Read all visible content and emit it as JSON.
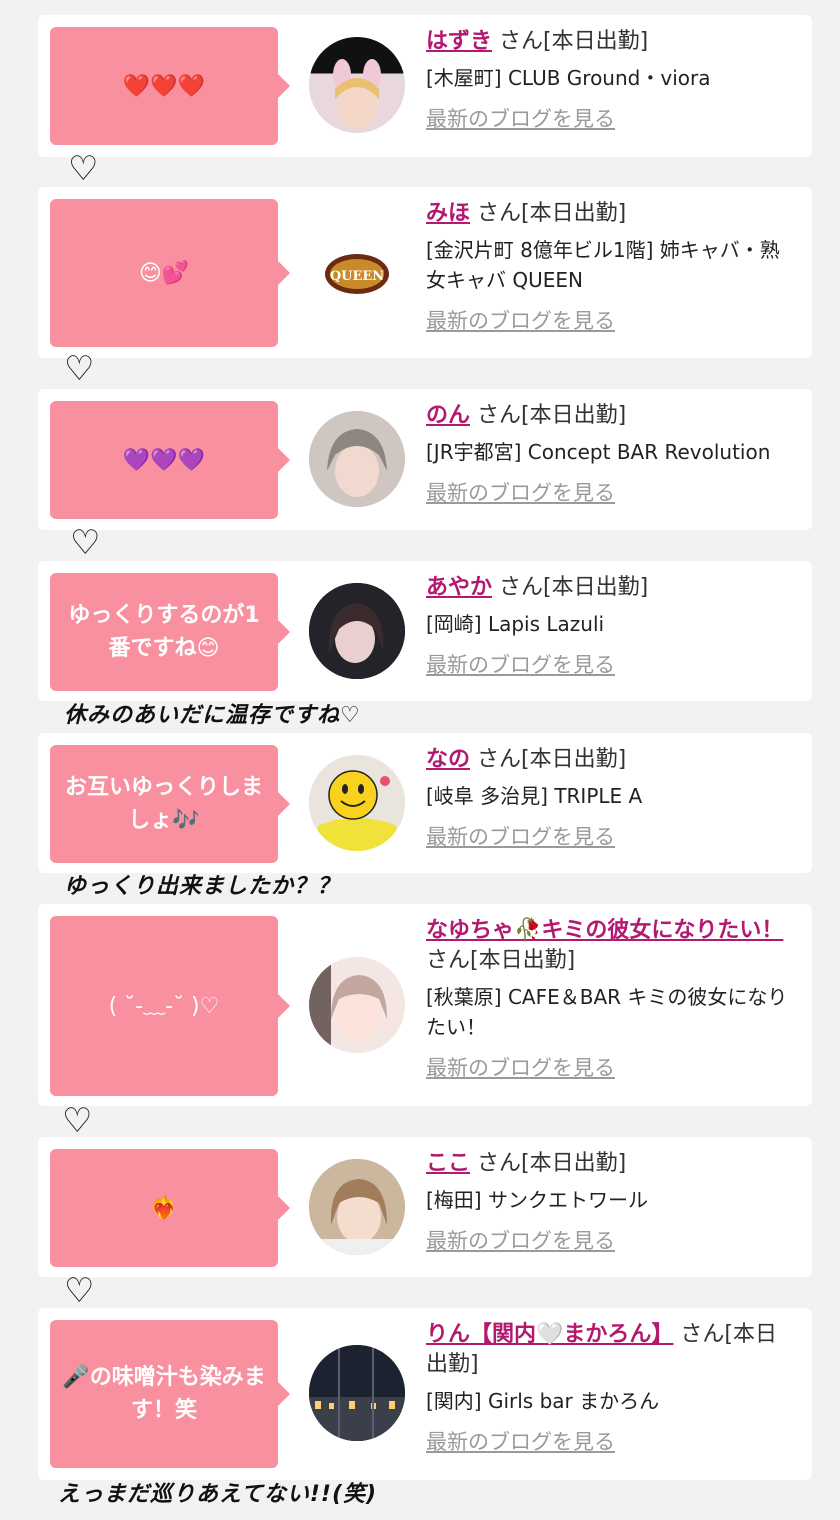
{
  "common": {
    "san": "さん",
    "status": "[本日出勤]",
    "blog_link": "最新のブログを見る"
  },
  "colors": {
    "bubble": "#f8909f",
    "name": "#b3196f",
    "link": "#9a9a9a",
    "background": "#f2f2f2"
  },
  "entries": [
    {
      "name": "はずき",
      "suffix": "さん[本日出勤]",
      "shop": "[木屋町] CLUB Ground・viora",
      "comment": "❤️❤️❤️",
      "blog": "最新のブログを見る",
      "avatar": "avatar-bunny-ears"
    },
    {
      "name": "みほ",
      "suffix": "さん[本日出勤]",
      "shop": "[金沢片町 8億年ビル1階] 姉キャバ・熟女キャバ QUEEN",
      "comment": "😊💕",
      "blog": "最新のブログを見る",
      "avatar": "avatar-queen-logo",
      "logo_text": "QUEEN"
    },
    {
      "name": "のん",
      "suffix": "さん[本日出勤]",
      "shop": "[JR宇都宮] Concept BAR Revolution",
      "comment": "💜💜💜",
      "blog": "最新のブログを見る",
      "avatar": "avatar-portrait"
    },
    {
      "name": "あやか",
      "suffix": "さん[本日出勤]",
      "shop": "[岡崎] Lapis Lazuli",
      "comment": "ゆっくりするのが1番ですね😊",
      "blog": "最新のブログを見る",
      "avatar": "avatar-portrait-dark"
    },
    {
      "name": "なの",
      "suffix": "さん[本日出勤]",
      "shop": "[岐阜 多治見] TRIPLE A",
      "comment": "お互いゆっくりしましょ🎶",
      "blog": "最新のブログを見る",
      "avatar": "avatar-smiley-face"
    },
    {
      "name": "なゆちゃ🥀キミの彼女になりたい！",
      "suffix": "さん[本日出勤]",
      "shop": "[秋葉原] CAFE＆BAR キミの彼女になりたい！",
      "comment": "( ˘-﹏-˘ )♡",
      "blog": "最新のブログを見る",
      "avatar": "avatar-portrait-light"
    },
    {
      "name": "ここ",
      "suffix": "さん[本日出勤]",
      "shop": "[梅田] サンクエトワール",
      "comment": "❤️‍🔥",
      "blog": "最新のブログを見る",
      "avatar": "avatar-portrait-blond"
    },
    {
      "name": "りん【関内🤍まかろん】",
      "suffix": "さん[本日出勤]",
      "shop": "[関内] Girls bar まかろん",
      "comment": "🎤の味噌汁も染みます！笑",
      "blog": "最新のブログを見る",
      "avatar": "avatar-night-view"
    }
  ],
  "doodles": {
    "heart": "♡",
    "note_4": "休みのあいだに温存ですね♡",
    "note_5": "ゆっくり出来ましたか？？",
    "note_8": "えっまだ巡りあえてない!!(笑)"
  }
}
